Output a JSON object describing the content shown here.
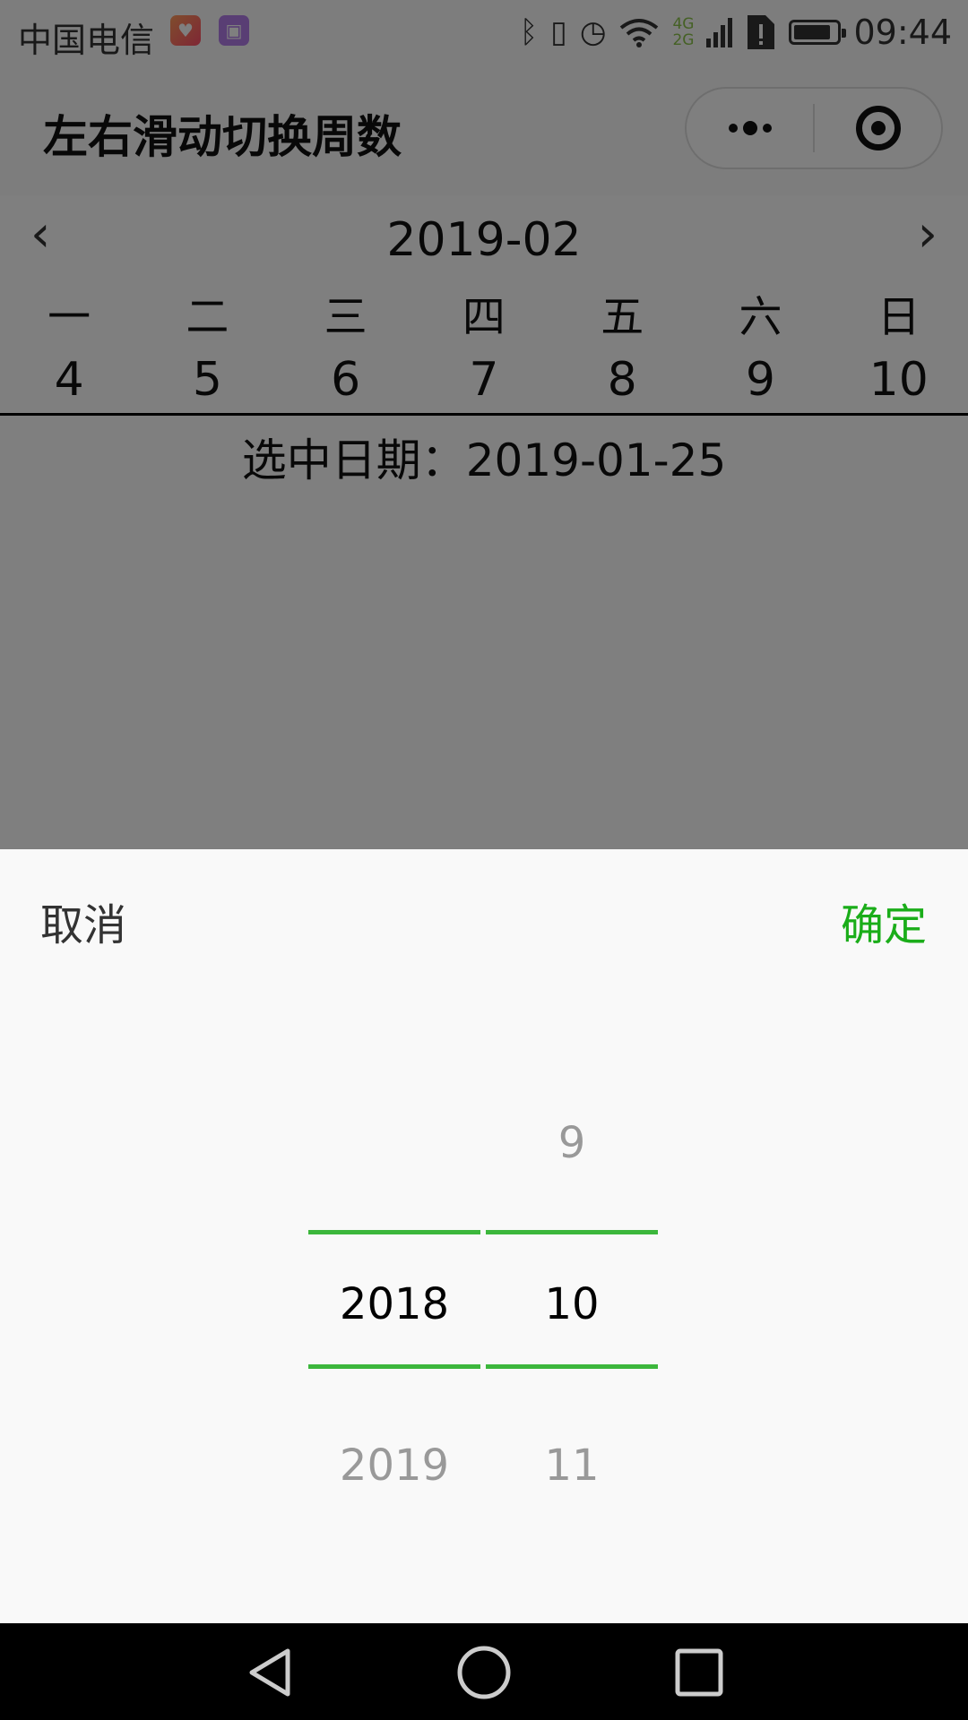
{
  "status_bar": {
    "carrier": "中国电信",
    "network": [
      "4G",
      "2G"
    ],
    "time": "09:44",
    "icons": [
      "health-app-icon",
      "gallery-app-icon",
      "bluetooth-icon",
      "vibrate-icon",
      "alarm-icon",
      "wifi-icon",
      "signal-icon",
      "sim-alert-icon",
      "battery-icon"
    ],
    "battery_level": 0.85
  },
  "nav": {
    "title": "左右滑动切换周数",
    "menu_icon": "more-dots-icon",
    "close_icon": "target-close-icon"
  },
  "calendar": {
    "month": "2019-02",
    "prev_icon": "chevron-left-icon",
    "next_icon": "chevron-right-icon",
    "weekdays": [
      "一",
      "二",
      "三",
      "四",
      "五",
      "六",
      "日"
    ],
    "days": [
      "4",
      "5",
      "6",
      "7",
      "8",
      "9",
      "10"
    ],
    "selected_date": "选中日期：2019-01-25"
  },
  "picker": {
    "cancel": "取消",
    "confirm": "确定",
    "confirm_color": "#1aad19",
    "indicator_color": "#3cb73c",
    "year": {
      "above": "",
      "selected": "2018",
      "below": "2019"
    },
    "month": {
      "above": "9",
      "selected": "10",
      "below": "11"
    }
  },
  "system_nav": {
    "icons": [
      "back-icon",
      "home-icon",
      "recent-apps-icon"
    ]
  }
}
